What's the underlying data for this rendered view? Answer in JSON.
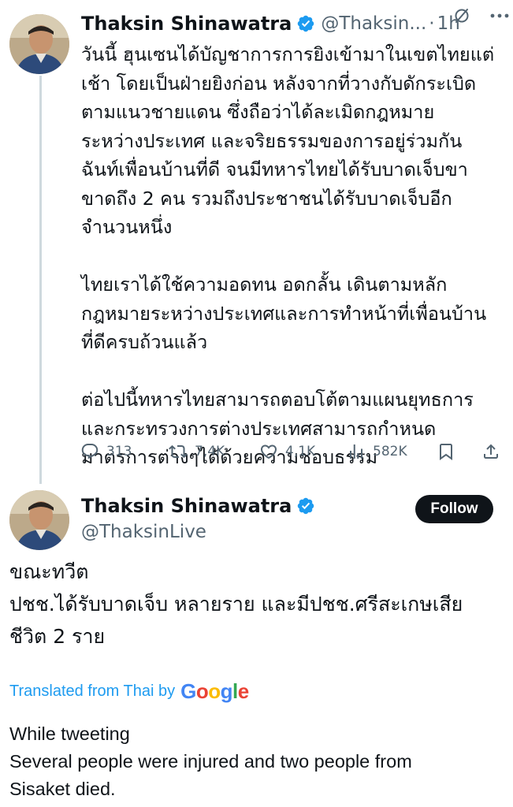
{
  "colors": {
    "text": "#0f1419",
    "secondary_text": "#536471",
    "link_blue": "#1d9bf0",
    "verified_blue": "#1d9bf0",
    "follow_bg": "#0f1419",
    "thread_line": "#cfd9de"
  },
  "post1": {
    "author_name": "Thaksin Shinawatra",
    "handle": "@Thaksin...",
    "separator": "·",
    "time": "1h",
    "icons": [
      "avatar",
      "verified-badge-icon",
      "grok-icon",
      "more-options-icon"
    ],
    "body_paragraphs": [
      {
        "lines": [
          "วันนี้ ฮุนเซนได้บัญชาการการยิงเข้ามาในเขตไทยแต่",
          "เช้า โดยเป็นฝ่ายยิงก่อน หลังจากที่วางกับดักระเบิด",
          "ตามแนวชายแดน ซึ่งถือว่าได้ละเมิดกฎหมาย",
          "ระหว่างประเทศ และจริยธรรมของการอยู่ร่วมกัน",
          "ฉันท์เพื่อนบ้านที่ดี จนมีทหารไทยได้รับบาดเจ็บขา",
          "ขาดถึง 2 คน รวมถึงประชาชนได้รับบาดเจ็บอีก",
          "จำนวนหนึ่ง"
        ]
      },
      {
        "lines": [
          "ไทยเราได้ใช้ความอดทน อดกลั้น เดินตามหลัก",
          "กฎหมายระหว่างประเทศและการทำหน้าที่เพื่อนบ้าน",
          "ที่ดีครบถ้วนแล้ว"
        ]
      },
      {
        "lines": [
          "ต่อไปนี้ทหารไทยสามารถตอบโต้ตามแผนยุทธการ",
          "และกระทรวงการต่างประเทศสามารถกำหนด",
          "มาตรการต่างๆได้ด้วยความชอบธรรม"
        ]
      }
    ],
    "actions": {
      "reply": {
        "icon": "reply-icon",
        "count": "313"
      },
      "repost": {
        "icon": "repost-icon",
        "count": "7,4K"
      },
      "like": {
        "icon": "like-icon",
        "count": "4,1K"
      },
      "views": {
        "icon": "views-icon",
        "count": "582K"
      },
      "bookmark": {
        "icon": "bookmark-icon"
      },
      "share": {
        "icon": "share-icon"
      }
    }
  },
  "post2": {
    "author_name": "Thaksin Shinawatra",
    "handle": "@ThaksinLive",
    "follow_label": "Follow",
    "body_lines": [
      "ขณะทวีต",
      "ปชช.ได้รับบาดเจ็บ หลายราย และมีปชช.ศรีสะเกษเสีย",
      "ชีวิต 2 ราย"
    ],
    "translated_label": "Translated from Thai by",
    "translation_provider_logo": "Google",
    "translation_lines": [
      "While tweeting",
      "Several people were injured and two people from",
      "Sisaket died."
    ]
  }
}
